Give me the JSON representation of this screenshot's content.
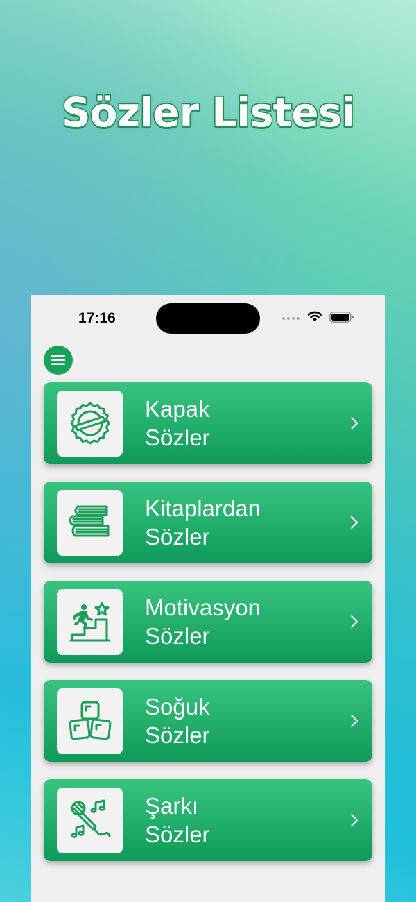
{
  "headline": "Sözler Listesi",
  "status_bar": {
    "time": "17:16",
    "icons": [
      "signal-dots-icon",
      "wifi-icon",
      "battery-icon"
    ]
  },
  "menu": {
    "icon": "hamburger-icon"
  },
  "categories": [
    {
      "line1": "Kapak",
      "line2": "Sözler",
      "icon": "badge-seal-icon"
    },
    {
      "line1": "Kitaplardan",
      "line2": "Sözler",
      "icon": "books-stack-icon"
    },
    {
      "line1": "Motivasyon",
      "line2": "Sözler",
      "icon": "stairs-star-icon"
    },
    {
      "line1": "Soğuk",
      "line2": "Sözler",
      "icon": "ice-cubes-icon"
    },
    {
      "line1": "Şarkı",
      "line2": "Sözler",
      "icon": "microphone-notes-icon"
    }
  ],
  "colors": {
    "accent": "#1aa25b",
    "card_top": "#38c47f",
    "card_bottom": "#0f9a59",
    "headline_stroke": "#1f8f55",
    "phone_bg": "#efefef"
  }
}
